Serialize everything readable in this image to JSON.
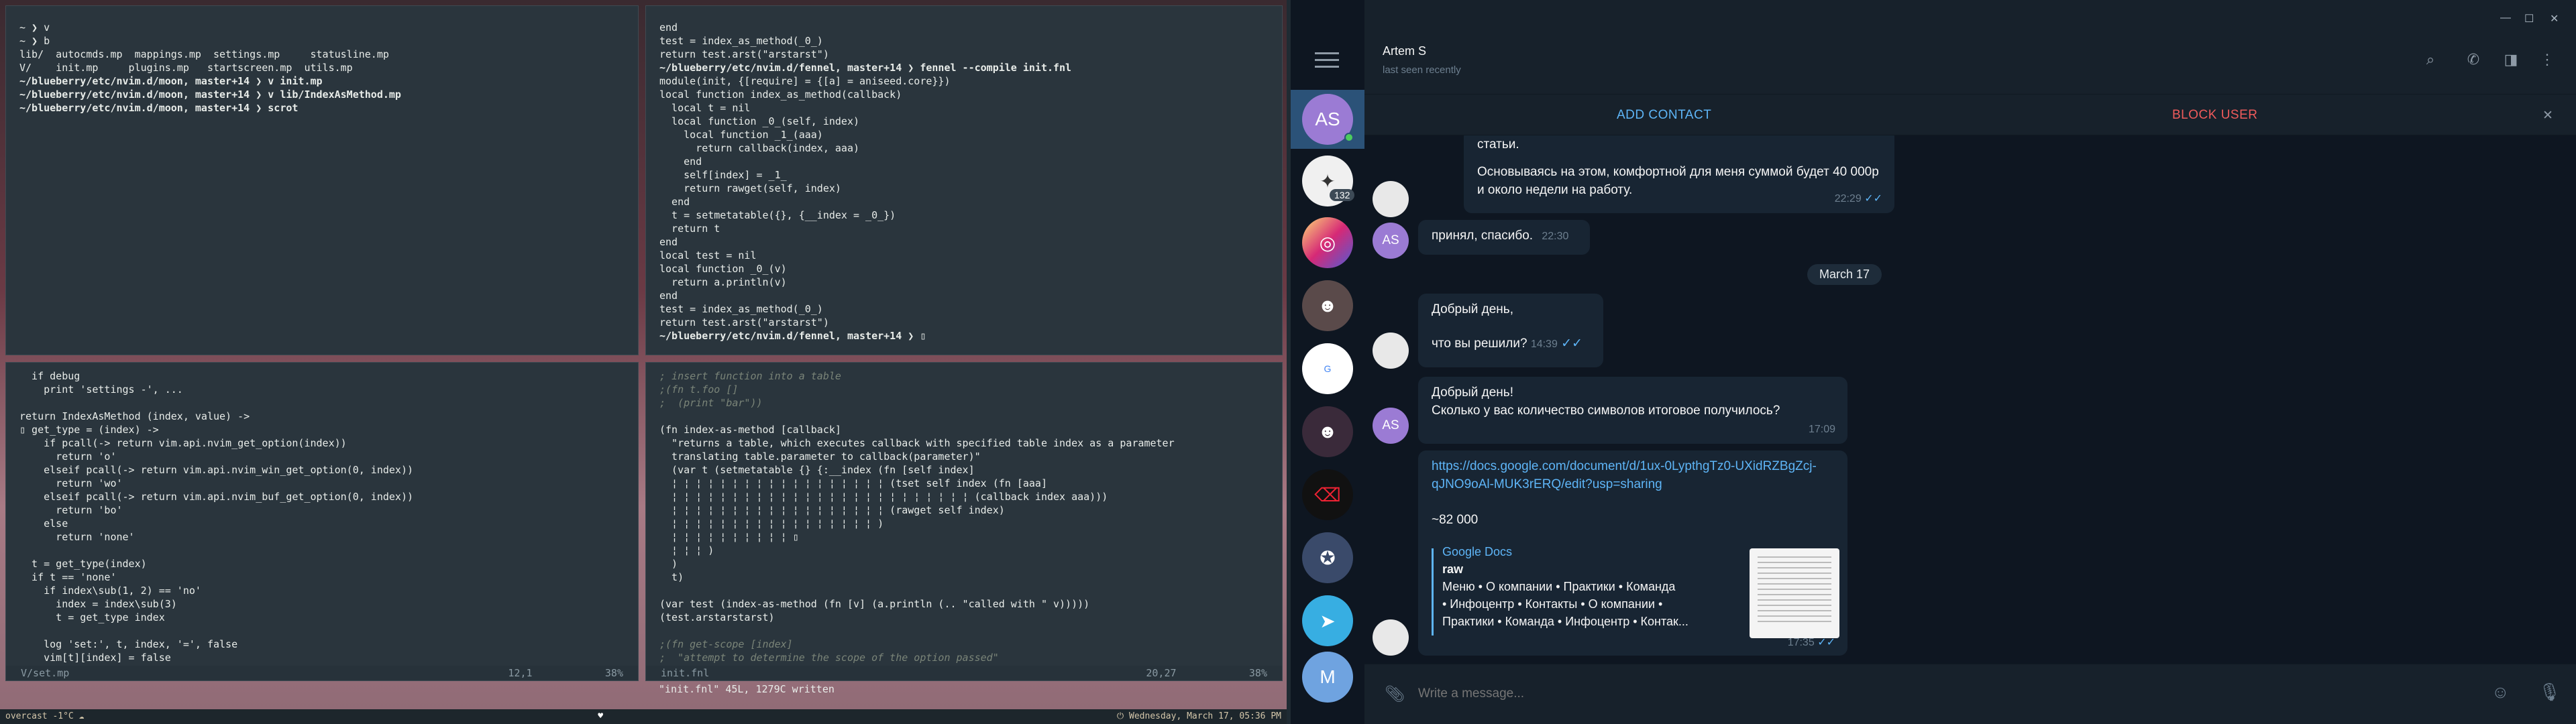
{
  "terminals": {
    "top_left": {
      "lines": [
        "~ ❯ v",
        "~ ❯ b",
        "lib/  autocmds.mp  mappings.mp  settings.mp     statusline.mp",
        "V/    init.mp     plugins.mp   startscreen.mp  utils.mp",
        "~/blueberry/etc/nvim.d/moon, master+14 ❯ v init.mp",
        "~/blueberry/etc/nvim.d/moon, master+14 ❯ v lib/IndexAsMethod.mp",
        "~/blueberry/etc/nvim.d/moon, master+14 ❯ scrot"
      ]
    },
    "top_right": {
      "lines": [
        "end",
        "test = index_as_method(_0_)",
        "return test.arst(\"arstarst\")",
        "~/blueberry/etc/nvim.d/fennel, master+14 ❯ fennel --compile init.fnl",
        "module(init, {[require] = {[a] = aniseed.core}})",
        "local function index_as_method(callback)",
        "  local t = nil",
        "  local function _0_(self, index)",
        "    local function _1_(aaa)",
        "      return callback(index, aaa)",
        "    end",
        "    self[index] = _1_",
        "    return rawget(self, index)",
        "  end",
        "  t = setmetatable({}, {__index = _0_})",
        "  return t",
        "end",
        "local test = nil",
        "local function _0_(v)",
        "  return a.println(v)",
        "end",
        "test = index_as_method(_0_)",
        "return test.arst(\"arstarst\")",
        "~/blueberry/etc/nvim.d/fennel, master+14 ❯ ▯"
      ]
    },
    "bottom_left": {
      "lines": [
        "  if debug",
        "    print 'settings -', ...",
        "",
        "return IndexAsMethod (index, value) ->",
        "▯ get_type = (index) ->",
        "    if pcall(-> return vim.api.nvim_get_option(index))",
        "      return 'o'",
        "    elseif pcall(-> return vim.api.nvim_win_get_option(0, index))",
        "      return 'wo'",
        "    elseif pcall(-> return vim.api.nvim_buf_get_option(0, index))",
        "      return 'bo'",
        "    else",
        "      return 'none'",
        "",
        "  t = get_type(index)",
        "  if t == 'none'",
        "    if index\\sub(1, 2) == 'no'",
        "      index = index\\sub(3)",
        "      t = get_type index",
        "",
        "    log 'set:', t, index, '=', false",
        "    vim[t][index] = false"
      ],
      "status_file": "V/set.mp",
      "status_pos": "12,1",
      "status_pct": "38%"
    },
    "bottom_right": {
      "lines": [
        "; insert function into a table",
        ";(fn t.foo []",
        ";  (print \"bar\"))",
        "",
        "(fn index-as-method [callback]",
        "  \"returns a table, which executes callback with specified table index as a parameter",
        "  translating table.parameter to callback(parameter)\"",
        "  (var t (setmetatable {} {:__index (fn [self index]",
        "  ¦ ¦ ¦ ¦ ¦ ¦ ¦ ¦ ¦ ¦ ¦ ¦ ¦ ¦ ¦ ¦ ¦ ¦ (tset self index (fn [aaa]",
        "  ¦ ¦ ¦ ¦ ¦ ¦ ¦ ¦ ¦ ¦ ¦ ¦ ¦ ¦ ¦ ¦ ¦ ¦ ¦ ¦ ¦ ¦ ¦ ¦ ¦ (callback index aaa)))",
        "  ¦ ¦ ¦ ¦ ¦ ¦ ¦ ¦ ¦ ¦ ¦ ¦ ¦ ¦ ¦ ¦ ¦ ¦ (rawget self index)",
        "  ¦ ¦ ¦ ¦ ¦ ¦ ¦ ¦ ¦ ¦ ¦ ¦ ¦ ¦ ¦ ¦ ¦ )",
        "  ¦ ¦ ¦ ¦ ¦ ¦ ¦ ¦ ¦ ¦ ▯",
        "  ¦ ¦ ¦ )",
        "  )",
        "  t)",
        "",
        "(var test (index-as-method (fn [v] (a.println (.. \"called with \" v)))))",
        "(test.arstarstarst)",
        "",
        ";(fn get-scope [index]",
        ";  \"attempt to determine the scope of the option passed\""
      ],
      "status_file": "init.fnl",
      "status_pos": "20,27",
      "status_pct": "38%",
      "message": "\"init.fnl\" 45L, 1279C written"
    }
  },
  "bottom_bar": {
    "left": "overcast -1°C ☁",
    "heart": "♥",
    "datetime": "Wednesday, March 17, 05:36 PM"
  },
  "telegram": {
    "contact_name": "Artem S",
    "last_seen": "last seen recently",
    "add_contact": "ADD CONTACT",
    "block_user": "BLOCK USER",
    "sidebar": {
      "as_initials": "AS",
      "unread_count": "132",
      "m_initial": "M"
    },
    "messages": [
      {
        "text": "статьи.",
        "time": ""
      },
      {
        "text": "Основываясь на этом, комфортной для меня суммой будет 40 000р и около недели на работу.",
        "time": "22:29"
      },
      {
        "text": "принял, спасибо.",
        "time": "22:30"
      },
      {
        "text": "Добрый день,",
        "time": ""
      },
      {
        "text": "что вы решили?",
        "time": "14:39"
      },
      {
        "text": "Добрый день!",
        "time": ""
      },
      {
        "text": "Сколько у вас количество символов итоговое получилось?",
        "time": "17:09"
      }
    ],
    "date_chip": "March 17",
    "link_message": {
      "url": "https://docs.google.com/document/d/1ux-0Lypthg Tz0-UXidRZBgZcj-qJNO9oAl-MUK3rERQ/edit?usp=sharing",
      "url_line1": "https://docs.google.com/document/d/1ux-0LypthgTz0-UXidRZBgZcj-",
      "url_line2": "qJNO9oAl-MUK3rERQ/edit?usp=sharing",
      "amount": "~82 000",
      "preview_site": "Google Docs",
      "preview_title": "raw",
      "preview_line1": "Меню   • О компании  • Практики  • Команда",
      "preview_line2": "• Инфоцентр  • Контакты   • О компании  •",
      "preview_line3": "Практики  • Команда  • Инфоцентр  • Контак...",
      "time": "17:35"
    },
    "composer_placeholder": "Write a message...",
    "colors": {
      "accent": "#5eb5f7",
      "bg": "#0e1621",
      "bubble": "#182533"
    }
  }
}
